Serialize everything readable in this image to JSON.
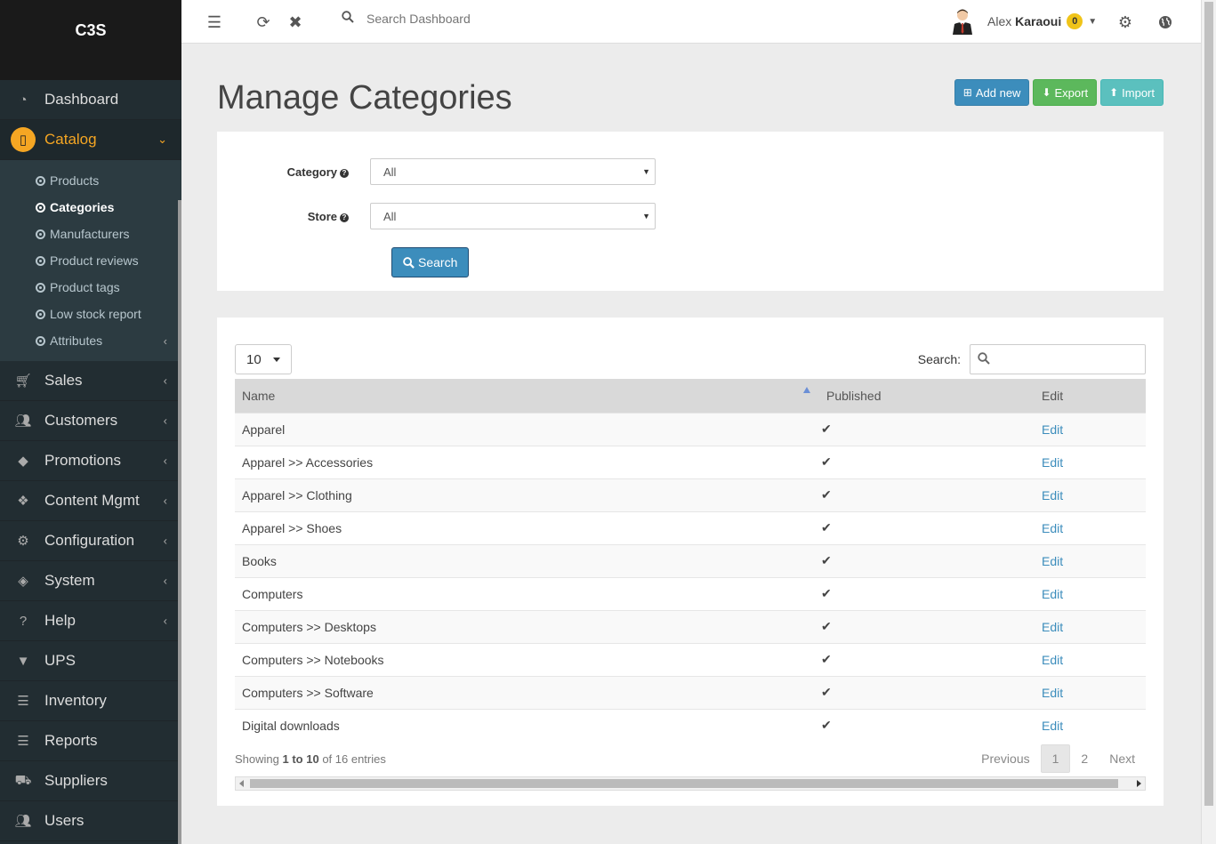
{
  "brand": "C3S",
  "sidebar": {
    "items": [
      {
        "label": "Dashboard",
        "icon": "dashboard-icon"
      },
      {
        "label": "Catalog",
        "icon": "book-icon"
      },
      {
        "label": "Sales",
        "icon": "cart-icon"
      },
      {
        "label": "Customers",
        "icon": "users-icon"
      },
      {
        "label": "Promotions",
        "icon": "tags-icon"
      },
      {
        "label": "Content Mgmt",
        "icon": "cubes-icon"
      },
      {
        "label": "Configuration",
        "icon": "gears-icon"
      },
      {
        "label": "System",
        "icon": "cube-icon"
      },
      {
        "label": "Help",
        "icon": "question-icon"
      },
      {
        "label": "UPS",
        "icon": "filter-icon"
      },
      {
        "label": "Inventory",
        "icon": "list-icon"
      },
      {
        "label": "Reports",
        "icon": "list-icon"
      },
      {
        "label": "Suppliers",
        "icon": "truck-icon"
      },
      {
        "label": "Users",
        "icon": "users-icon"
      }
    ],
    "catalog_sub": [
      {
        "label": "Products"
      },
      {
        "label": "Categories"
      },
      {
        "label": "Manufacturers"
      },
      {
        "label": "Product reviews"
      },
      {
        "label": "Product tags"
      },
      {
        "label": "Low stock report"
      },
      {
        "label": "Attributes"
      }
    ]
  },
  "topbar": {
    "search_placeholder": "Search Dashboard",
    "user_first": "Alex",
    "user_last": "Karaoui",
    "badge": "0"
  },
  "page": {
    "title": "Manage Categories",
    "add_new": "Add new",
    "export": "Export",
    "import": "Import"
  },
  "filters": {
    "category_label": "Category",
    "category_value": "All",
    "store_label": "Store",
    "store_value": "All",
    "search_button": "Search"
  },
  "table": {
    "page_length": "10",
    "search_label": "Search:",
    "columns": [
      "Name",
      "Published",
      "Edit"
    ],
    "rows": [
      {
        "name": "Apparel",
        "edit": "Edit"
      },
      {
        "name": "Apparel >> Accessories",
        "edit": "Edit"
      },
      {
        "name": "Apparel >> Clothing",
        "edit": "Edit"
      },
      {
        "name": "Apparel >> Shoes",
        "edit": "Edit"
      },
      {
        "name": "Books",
        "edit": "Edit"
      },
      {
        "name": "Computers",
        "edit": "Edit"
      },
      {
        "name": "Computers >> Desktops",
        "edit": "Edit"
      },
      {
        "name": "Computers >> Notebooks",
        "edit": "Edit"
      },
      {
        "name": "Computers >> Software",
        "edit": "Edit"
      },
      {
        "name": "Digital downloads",
        "edit": "Edit"
      }
    ],
    "info_prefix": "Showing",
    "info_range": "1 to 10",
    "info_suffix": "of 16 entries",
    "pager": {
      "previous": "Previous",
      "pages": [
        "1",
        "2"
      ],
      "next": "Next"
    }
  },
  "colors": {
    "accent": "#f5a623",
    "primary": "#3c8dbc",
    "success": "#5cb85c",
    "info": "#5bc0be",
    "sidebar": "#222d32"
  }
}
